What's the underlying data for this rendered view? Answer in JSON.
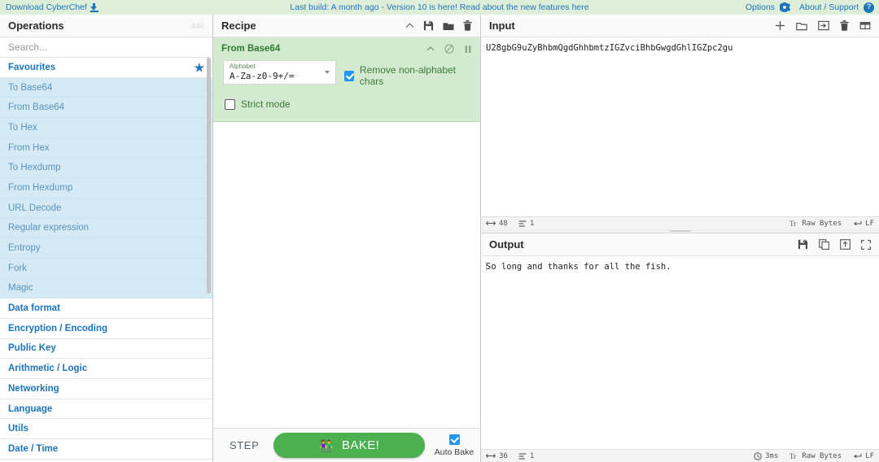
{
  "banner": {
    "download_label": "Download CyberChef",
    "download_icon": "download-icon",
    "build_text": "Last build: A month ago - Version 10 is here! Read about the new features ",
    "build_link": "here",
    "options_label": "Options",
    "options_icon": "gear-icon",
    "about_label": "About / Support",
    "about_icon": "question-circle-icon"
  },
  "operations": {
    "title": "Operations",
    "count": "440",
    "search_placeholder": "Search...",
    "search_value": "",
    "favourites": {
      "label": "Favourites",
      "star_icon": "star-icon"
    },
    "favourite_items": [
      {
        "label": "To Base64"
      },
      {
        "label": "From Base64"
      },
      {
        "label": "To Hex"
      },
      {
        "label": "From Hex"
      },
      {
        "label": "To Hexdump"
      },
      {
        "label": "From Hexdump"
      },
      {
        "label": "URL Decode"
      },
      {
        "label": "Regular expression"
      },
      {
        "label": "Entropy"
      },
      {
        "label": "Fork"
      },
      {
        "label": "Magic"
      }
    ],
    "categories": [
      {
        "label": "Data format"
      },
      {
        "label": "Encryption / Encoding"
      },
      {
        "label": "Public Key"
      },
      {
        "label": "Arithmetic / Logic"
      },
      {
        "label": "Networking"
      },
      {
        "label": "Language"
      },
      {
        "label": "Utils"
      },
      {
        "label": "Date / Time"
      }
    ]
  },
  "recipe": {
    "title": "Recipe",
    "icons": [
      "chevron-up-icon",
      "save-icon",
      "folder-icon",
      "trash-icon"
    ],
    "operation": {
      "name": "From Base64",
      "icons": [
        "chevron-up-icon",
        "disable-icon",
        "pause-icon"
      ],
      "alphabet_label": "Alphabet",
      "alphabet_value": "A-Za-z0-9+/=",
      "remove_non_alphabet_label": "Remove non-alphabet chars",
      "remove_non_alphabet_checked": true,
      "strict_mode_label": "Strict mode",
      "strict_mode_checked": false
    },
    "step_label": "STEP",
    "bake_label": "BAKE!",
    "bake_icon": "chef-icon",
    "auto_bake_label": "Auto Bake",
    "auto_bake_checked": true
  },
  "input": {
    "title": "Input",
    "icons": [
      "plus-icon",
      "folder-icon",
      "open-folder-as-input-icon",
      "trash-icon",
      "tabs-icon"
    ],
    "value": "U28gbG9uZyBhbmQgdGhhbmtzIGZvciBhbGwgdGhlIGZpc2gu",
    "status": {
      "length_icon": "length-icon",
      "length": "48",
      "lines_icon": "lines-icon",
      "lines": "1",
      "encoding_icon": "font-icon",
      "encoding": "Raw Bytes",
      "line_ending_icon": "return-icon",
      "line_ending": "LF"
    }
  },
  "output": {
    "title": "Output",
    "icons": [
      "save-icon",
      "copy-icon",
      "replace-input-icon",
      "maximise-icon"
    ],
    "value": "So long and thanks for all the fish.",
    "status": {
      "length_icon": "length-icon",
      "length": "36",
      "lines_icon": "lines-icon",
      "lines": "1",
      "time_icon": "clock-icon",
      "time": "3ms",
      "encoding_icon": "font-icon",
      "encoding": "Raw Bytes",
      "line_ending_icon": "return-icon",
      "line_ending": "LF"
    }
  },
  "colors": {
    "banner_bg": "#dfeed8",
    "link": "#1c75bc",
    "op_block_bg": "#d4ead0",
    "favourite_bg": "#d5eaf5",
    "bake_green": "#4cb050"
  }
}
